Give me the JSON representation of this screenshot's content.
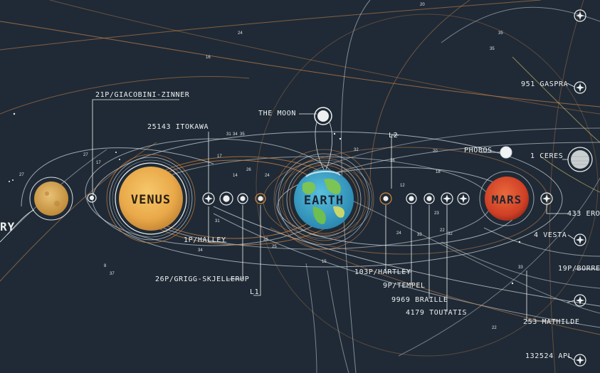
{
  "labels": {
    "giacobini": "21P/GIACOBINI-ZINNER",
    "itokawa": "25143 ITOKAWA",
    "moon": "THE MOON",
    "l2": "L2",
    "phobos": "PHOBOS",
    "ceres": "1 CERES",
    "gaspra": "951 GASPRA",
    "eros": "433 ERO",
    "vesta": "4 VESTA",
    "borrelly": "19P/BORREL",
    "mathilde": "253 MATHILDE",
    "apl": "132524 APL",
    "halley": "1P/HALLEY",
    "grigg": "26P/GRIGG-SKJELLERUP",
    "l1": "L1",
    "hartley": "103P/HARTLEY",
    "tempel": "9P/TEMPEL",
    "braille": "9969 BRAILLE",
    "toutatis": "4179 TOUTATIS",
    "mercury_tail": "RY"
  },
  "planets": {
    "venus": "VENUS",
    "earth": "EARTH",
    "mars": "MARS"
  },
  "numbers": {
    "n20_top": "20",
    "n24_a": "24",
    "n16": "16",
    "n35_a": "35",
    "n35_b": "35",
    "n27_a": "27",
    "n27_b": "27",
    "n17_a": "17",
    "n17_b": "17",
    "n31": "31",
    "n34_a": "34",
    "n35_c": "35",
    "n14": "14",
    "n26": "26",
    "n24_b": "24",
    "n32": "32",
    "n36": "36",
    "n20_mid": "20",
    "n18": "18",
    "n12": "12",
    "n33_a": "33",
    "n23": "23",
    "n22_a": "22",
    "n32_b": "32",
    "n33_b": "33",
    "n31_b": "31",
    "n34_b": "34",
    "n8": "8",
    "n37": "37",
    "n15": "15",
    "n24_c": "24",
    "n22_b": "22",
    "n26_b": "26",
    "n25": "25"
  },
  "colors": {
    "background": "#1f2a36",
    "orbit_white": "#d6dde2",
    "orbit_orange": "#d4873c",
    "venus": "#e9a94a",
    "earth_ocean": "#3aa3c7",
    "earth_land": "#6dbf4f",
    "mars": "#d6452a",
    "ceres": "#c9ced1",
    "mercury": "#d8a548"
  }
}
